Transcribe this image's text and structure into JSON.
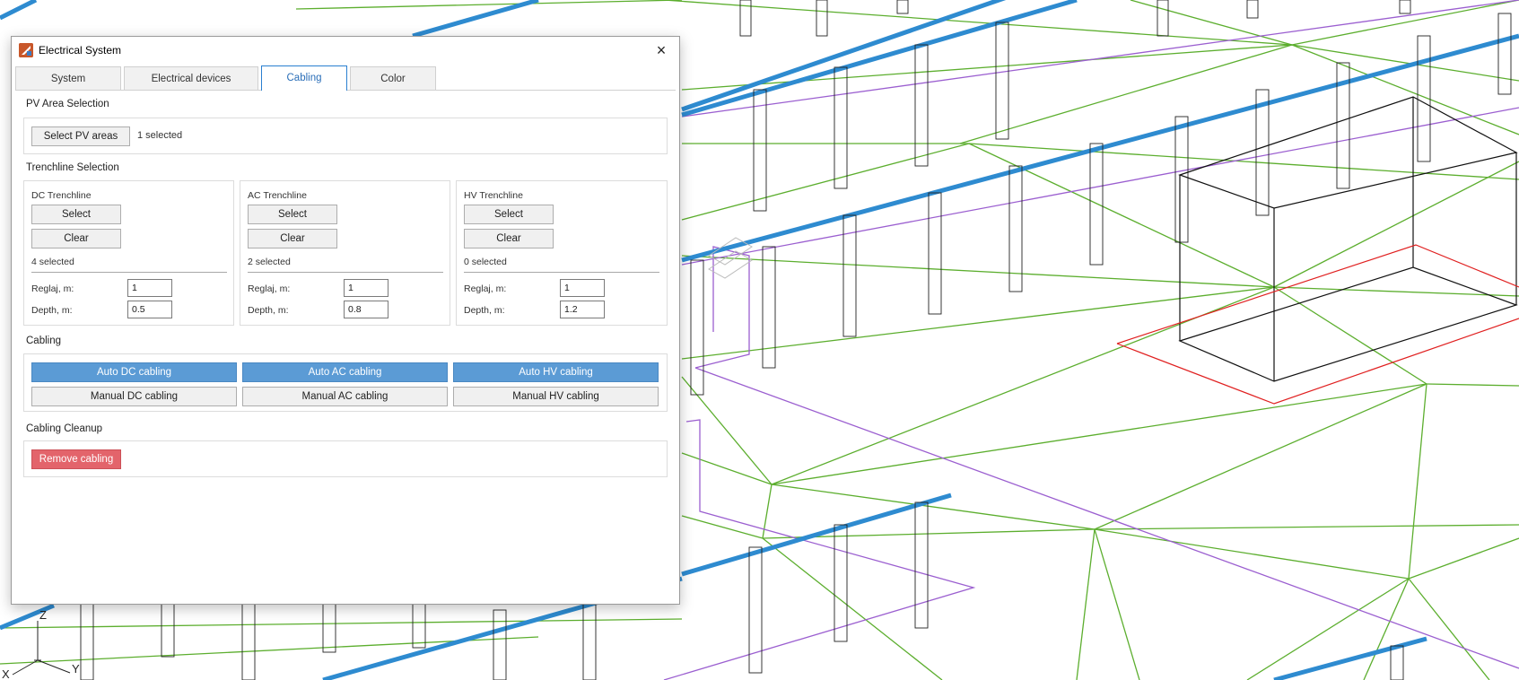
{
  "window": {
    "title": "Electrical System",
    "close_icon": "×"
  },
  "tabs": [
    {
      "label": "System",
      "active": false
    },
    {
      "label": "Electrical devices",
      "active": false
    },
    {
      "label": "Cabling",
      "active": true
    },
    {
      "label": "Color",
      "active": false
    }
  ],
  "pv_area": {
    "section_title": "PV Area Selection",
    "button": "Select PV areas",
    "status": "1 selected"
  },
  "trenchline": {
    "section_title": "Trenchline Selection",
    "groups": [
      {
        "title": "DC Trenchline",
        "select": "Select",
        "clear": "Clear",
        "status": "4 selected",
        "reglaj_label": "Reglaj, m:",
        "reglaj_value": "1",
        "depth_label": "Depth, m:",
        "depth_value": "0.5"
      },
      {
        "title": "AC Trenchline",
        "select": "Select",
        "clear": "Clear",
        "status": "2 selected",
        "reglaj_label": "Reglaj, m:",
        "reglaj_value": "1",
        "depth_label": "Depth, m:",
        "depth_value": "0.8"
      },
      {
        "title": "HV Trenchline",
        "select": "Select",
        "clear": "Clear",
        "status": "0 selected",
        "reglaj_label": "Reglaj, m:",
        "reglaj_value": "1",
        "depth_label": "Depth, m:",
        "depth_value": "1.2"
      }
    ]
  },
  "cabling": {
    "section_title": "Cabling",
    "auto_dc": "Auto DC cabling",
    "auto_ac": "Auto AC cabling",
    "auto_hv": "Auto HV cabling",
    "manual_dc": "Manual DC cabling",
    "manual_ac": "Manual AC cabling",
    "manual_hv": "Manual HV cabling"
  },
  "cleanup": {
    "section_title": "Cabling Cleanup",
    "remove": "Remove cabling"
  },
  "axis": {
    "z": "Z",
    "x": "X",
    "y": "Y"
  },
  "colors": {
    "accent": "#5b9bd5",
    "danger": "#e3646b",
    "green_lines": "#5cae2e",
    "purple_lines": "#9b5fd0",
    "blue_beams": "#2e8bd0",
    "red_outline": "#e02020"
  }
}
